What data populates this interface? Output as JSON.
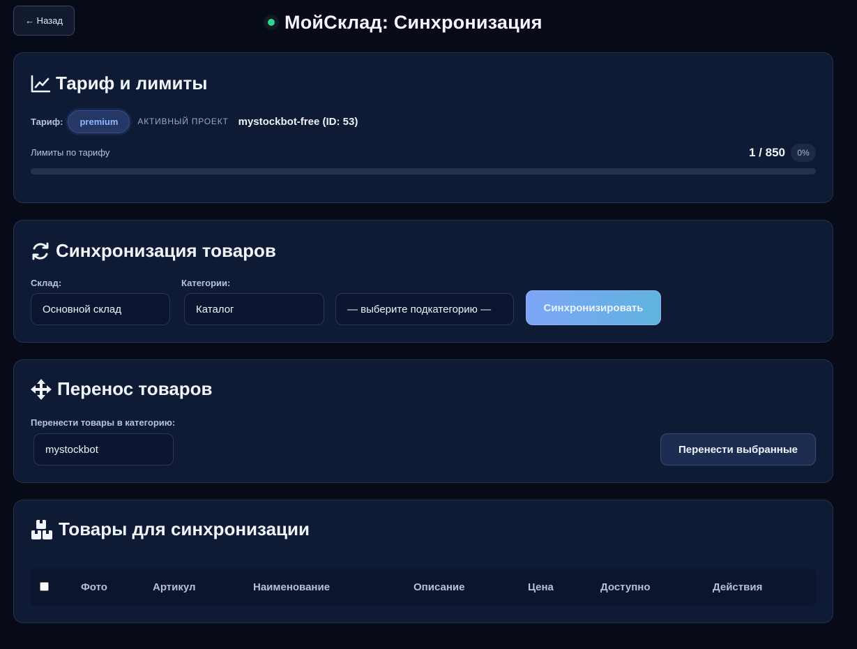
{
  "header": {
    "back_label": "← Назад",
    "title": "МойСклад: Синхронизация",
    "status_color": "#2fd68f"
  },
  "tariff": {
    "title": "Тариф и лимиты",
    "icon": "chart-line-icon",
    "tariff_label": "Тариф:",
    "plan": "premium",
    "active_project_label": "АКТИВНЫЙ ПРОЕКТ",
    "project_name": "mystockbot-free (ID: 53)",
    "limits_label": "Лимиты по тарифу",
    "limits_value": "1 / 850",
    "limits_percent_text": "0%",
    "usage_fraction": 0.0
  },
  "sync": {
    "title": "Синхронизация товаров",
    "icon": "sync-icon",
    "warehouse_label": "Склад:",
    "warehouse_value": "Основной склад",
    "categories_label": "Категории:",
    "category_value": "Каталог",
    "subcategory_value": "— выберите подкатегорию —",
    "sync_button": "Синхронизировать"
  },
  "move": {
    "title": "Перенос товаров",
    "icon": "move-arrows-icon",
    "target_label": "Перенести товары в категорию:",
    "target_value": "mystockbot",
    "move_button": "Перенести выбранные"
  },
  "products": {
    "title": "Товары для синхронизации",
    "icon": "boxes-icon",
    "columns": [
      "Фото",
      "Артикул",
      "Наименование",
      "Описание",
      "Цена",
      "Доступно",
      "Действия"
    ]
  }
}
